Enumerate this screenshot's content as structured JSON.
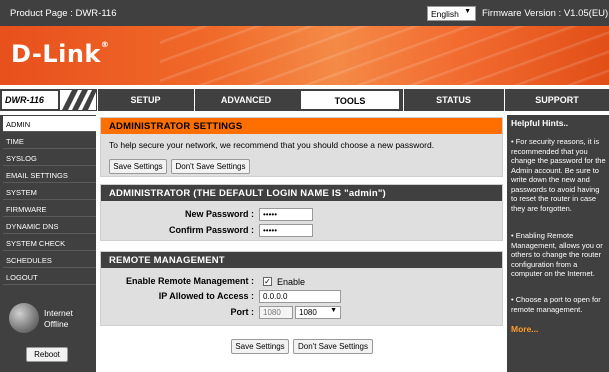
{
  "topbar": {
    "product": "Product Page :  DWR-116",
    "language": "English",
    "firmware": "Firmware Version : V1.05(EU)"
  },
  "brand": {
    "logo": "D-Link",
    "reg": "®",
    "model": "DWR-116"
  },
  "tabs": [
    {
      "label": "SETUP"
    },
    {
      "label": "ADVANCED"
    },
    {
      "label": "TOOLS"
    },
    {
      "label": "STATUS"
    },
    {
      "label": "SUPPORT"
    }
  ],
  "active_tab": "TOOLS",
  "sidebar": {
    "items": [
      {
        "label": "ADMIN"
      },
      {
        "label": "TIME"
      },
      {
        "label": "SYSLOG"
      },
      {
        "label": "EMAIL SETTINGS"
      },
      {
        "label": "SYSTEM"
      },
      {
        "label": "FIRMWARE"
      },
      {
        "label": "DYNAMIC DNS"
      },
      {
        "label": "SYSTEM CHECK"
      },
      {
        "label": "SCHEDULES"
      },
      {
        "label": "LOGOUT"
      }
    ],
    "active": "ADMIN",
    "status_line1": "Internet",
    "status_line2": "Offline",
    "reboot": "Reboot"
  },
  "admin_settings": {
    "title": "ADMINISTRATOR SETTINGS",
    "description": "To help secure your network, we recommend that you should choose a new password.",
    "save": "Save Settings",
    "dont_save": "Don't Save Settings"
  },
  "administrator": {
    "title": "ADMINISTRATOR (THE DEFAULT LOGIN NAME IS \"admin\")",
    "new_password_label": "New Password :",
    "new_password_value": "•••••",
    "confirm_password_label": "Confirm Password :",
    "confirm_password_value": "•••••"
  },
  "remote": {
    "title": "REMOTE MANAGEMENT",
    "enable_label": "Enable Remote Management :",
    "enable_check": "✓",
    "enable_text": "Enable",
    "ip_label": "IP Allowed to Access :",
    "ip_value": "0.0.0.0",
    "port_label": "Port :",
    "port_value": "1080",
    "port_select": "1080"
  },
  "bottom": {
    "save": "Save Settings",
    "dont_save": "Don't Save Settings"
  },
  "hints": {
    "title": "Helpful Hints..",
    "hint1": "• For security reasons, it is recommended that you change the password for the Admin account. Be sure to write down the new and passwords to avoid having to reset the router in case they are forgotten.",
    "hint2": "• Enabling Remote Management, allows you or others to change the router configuration from a computer on the Internet.",
    "hint3": "• Choose a port to open for remote management.",
    "more": "More..."
  },
  "colors": {
    "header_bg": "#404040",
    "accent_orange": "#ff6f00",
    "section_bg": "#dfdfdf"
  }
}
